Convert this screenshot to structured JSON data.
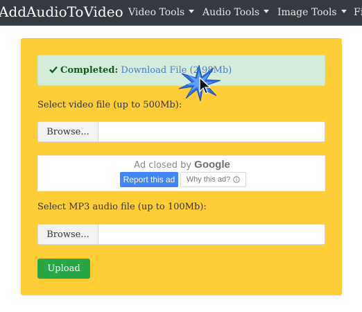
{
  "navbar": {
    "brand": "AddAudioToVideo",
    "items": [
      {
        "label": "Video Tools"
      },
      {
        "label": "Audio Tools"
      },
      {
        "label": "Image Tools"
      },
      {
        "label": "Fi"
      }
    ]
  },
  "alert": {
    "status": "Completed:",
    "link_text": "Download File (2.98Mb)"
  },
  "video": {
    "label": "Select video file (up to 500Mb):",
    "browse_label": "Browse..."
  },
  "ad": {
    "closed_text": "Ad closed by",
    "brand": "Google",
    "report_label": "Report this ad",
    "why_label": "Why this ad?"
  },
  "audio": {
    "label": "Select MP3 audio file (up to 100Mb):",
    "browse_label": "Browse..."
  },
  "upload": {
    "label": "Upload"
  },
  "colors": {
    "navbar": "#343a40",
    "card": "#ffcd38",
    "alert_bg": "#d4edda",
    "upload": "#28a745",
    "report": "#4285f4"
  },
  "icons": [
    "check-icon",
    "chevron-down-icon",
    "info-icon",
    "cursor-icon",
    "click-burst-icon"
  ]
}
